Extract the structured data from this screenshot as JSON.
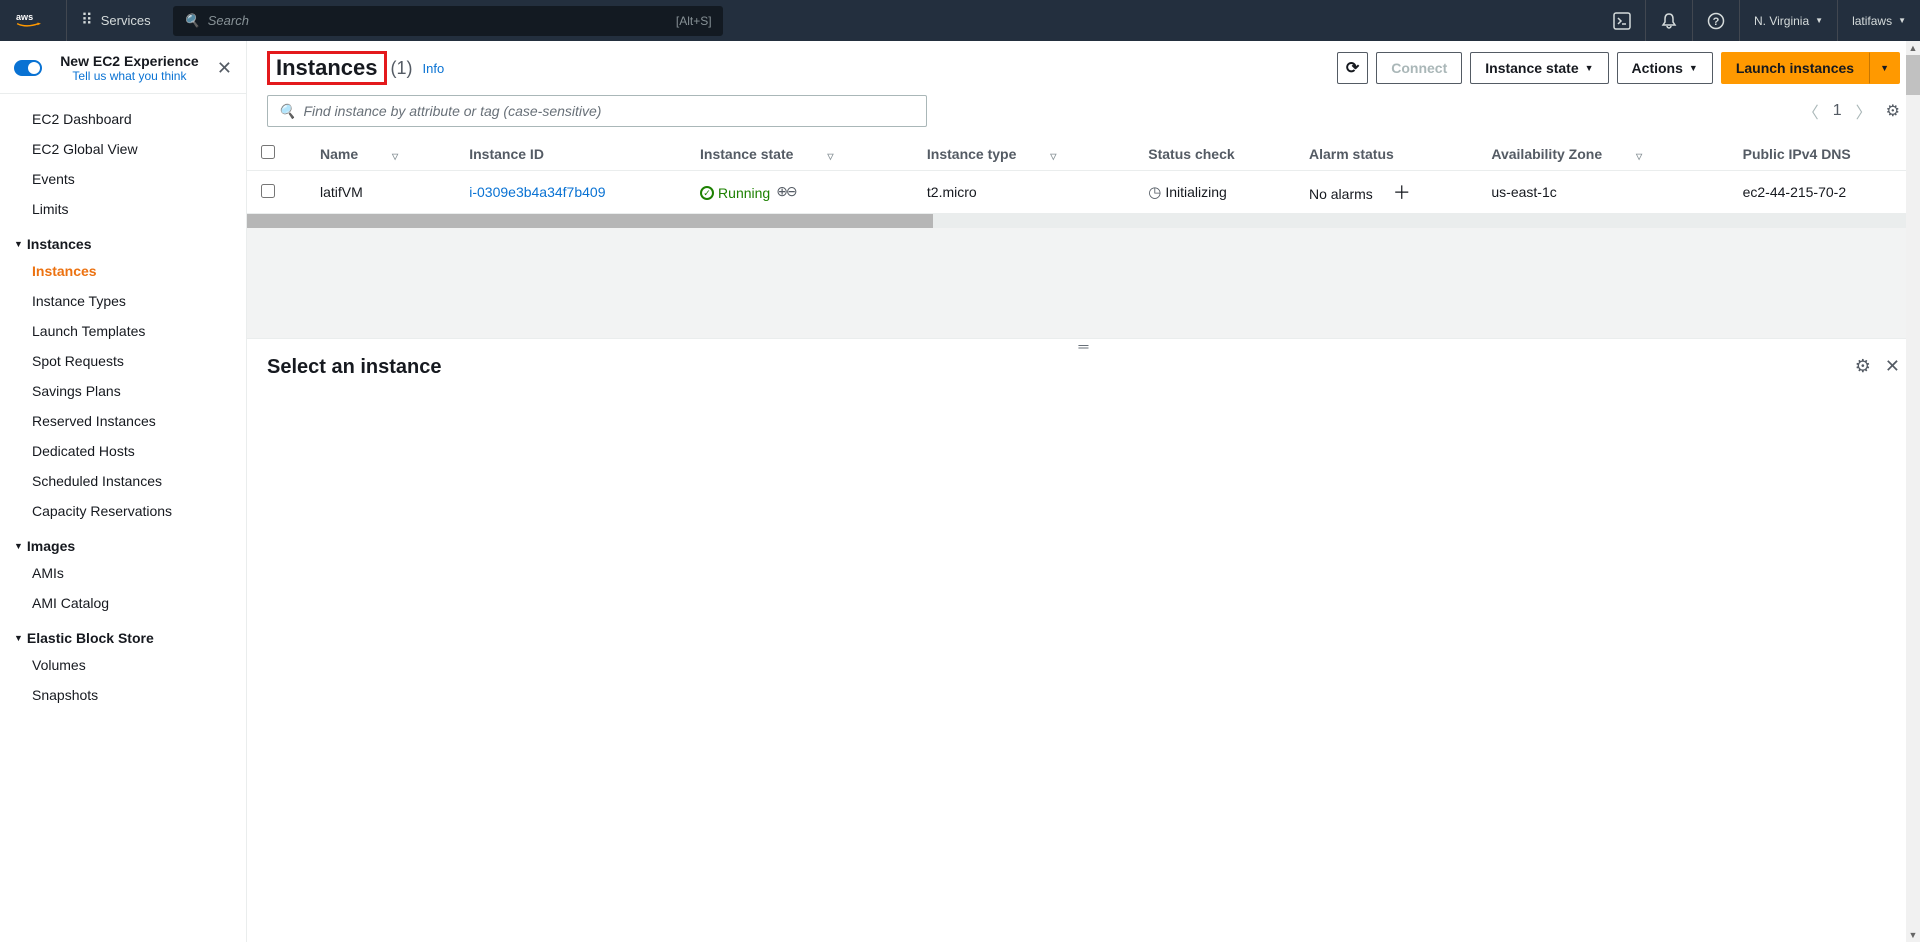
{
  "topnav": {
    "services_label": "Services",
    "search_placeholder": "Search",
    "search_kbd": "[Alt+S]",
    "region": "N. Virginia",
    "account": "latifaws"
  },
  "sidebar": {
    "new_exp_title": "New EC2 Experience",
    "new_exp_sub": "Tell us what you think",
    "groups": [
      {
        "items": [
          "EC2 Dashboard",
          "EC2 Global View",
          "Events",
          "Limits"
        ]
      },
      {
        "header": "Instances",
        "items": [
          "Instances",
          "Instance Types",
          "Launch Templates",
          "Spot Requests",
          "Savings Plans",
          "Reserved Instances",
          "Dedicated Hosts",
          "Scheduled Instances",
          "Capacity Reservations"
        ],
        "active": "Instances"
      },
      {
        "header": "Images",
        "items": [
          "AMIs",
          "AMI Catalog"
        ]
      },
      {
        "header": "Elastic Block Store",
        "items": [
          "Volumes",
          "Snapshots"
        ]
      }
    ]
  },
  "page": {
    "title": "Instances",
    "count": "(1)",
    "info": "Info",
    "connect": "Connect",
    "instance_state": "Instance state",
    "actions": "Actions",
    "launch": "Launch instances",
    "filter_placeholder": "Find instance by attribute or tag (case-sensitive)",
    "page_num": "1"
  },
  "table": {
    "columns": [
      "Name",
      "Instance ID",
      "Instance state",
      "Instance type",
      "Status check",
      "Alarm status",
      "Availability Zone",
      "Public IPv4 DNS"
    ],
    "rows": [
      {
        "name": "latifVM",
        "instance_id": "i-0309e3b4a34f7b409",
        "state": "Running",
        "type": "t2.micro",
        "status": "Initializing",
        "alarm": "No alarms",
        "az": "us-east-1c",
        "dns": "ec2-44-215-70-2"
      }
    ]
  },
  "detail": {
    "title": "Select an instance"
  }
}
